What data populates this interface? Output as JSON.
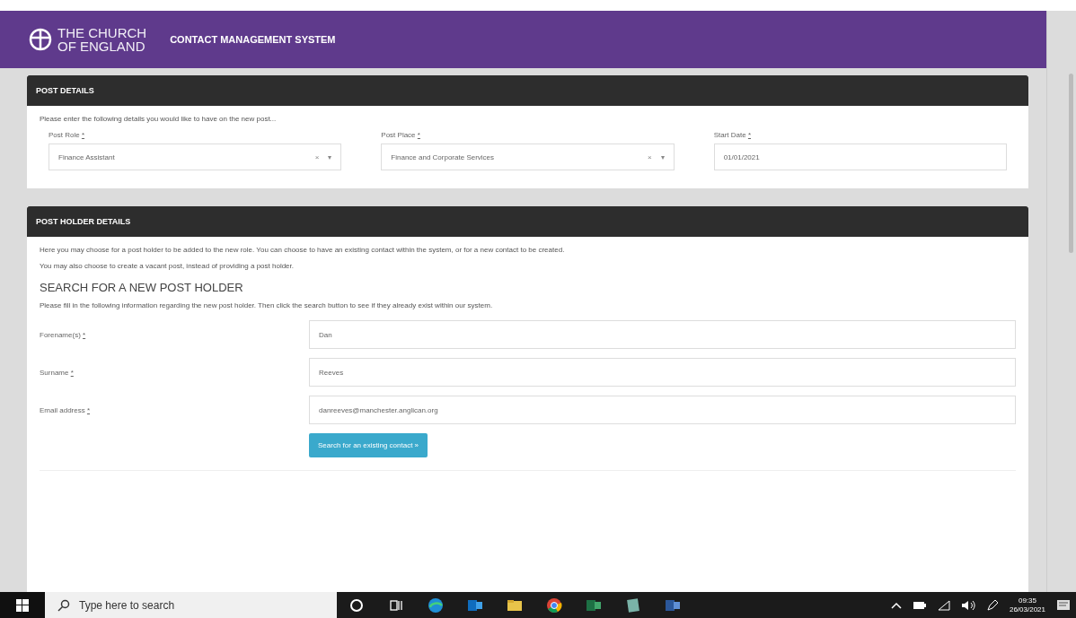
{
  "header": {
    "logo_line1": "THE CHURCH",
    "logo_line2": "OF ENGLAND",
    "title": "CONTACT MANAGEMENT SYSTEM"
  },
  "post_details": {
    "title": "POST DETAILS",
    "intro": "Please enter the following details you would like to have on the new post...",
    "fields": [
      {
        "kind": "select",
        "label": "Post Role",
        "required": "*",
        "value": "Finance Assistant",
        "clear": "×",
        "caret": "▾"
      },
      {
        "kind": "select",
        "label": "Post Place",
        "required": "*",
        "value": "Finance and Corporate Services",
        "clear": "×",
        "caret": "▾"
      },
      {
        "kind": "text",
        "label": "Start Date",
        "required": "*",
        "value": "01/01/2021"
      }
    ]
  },
  "post_holder": {
    "title": "POST HOLDER DETAILS",
    "paragraphs": [
      "Here you may choose for a post holder to be added to the new role. You can choose to have an existing contact within the system, or for a new contact to be created.",
      "You may also choose to create a vacant post, instead of providing a post holder."
    ],
    "search_heading": "SEARCH FOR A NEW POST HOLDER",
    "search_intro": "Please fill in the following information regarding the new post holder. Then click the search button to see if they already exist within our system.",
    "fields": [
      {
        "label": "Forename(s)",
        "required": "*",
        "value": "Dan"
      },
      {
        "label": "Surname",
        "required": "*",
        "value": "Reeves"
      },
      {
        "label": "Email address",
        "required": "*",
        "value": "danreeves@manchester.anglican.org"
      }
    ],
    "button": "Search for an existing contact »"
  },
  "taskbar": {
    "search_placeholder": "Type here to search",
    "time": "09:35",
    "date": "26/03/2021"
  }
}
